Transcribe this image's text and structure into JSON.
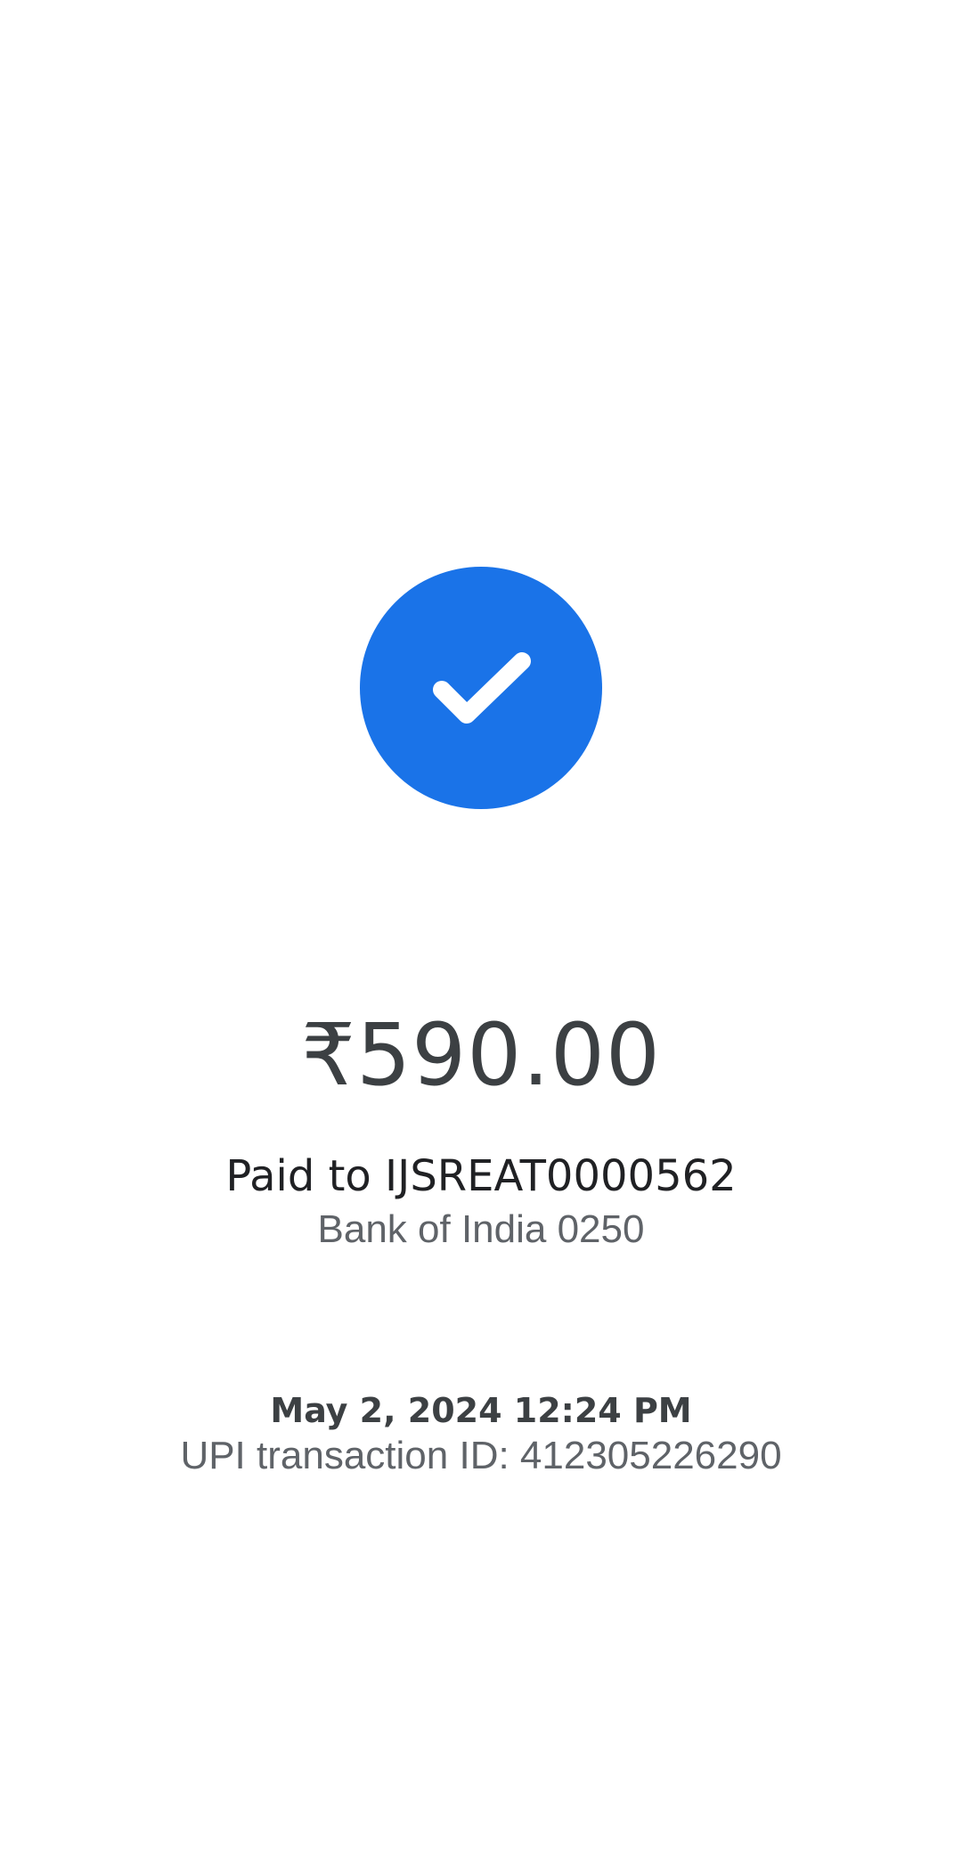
{
  "status": {
    "icon": "check-icon",
    "color": "#1a73e8"
  },
  "payment": {
    "amount": "₹590.00",
    "paid_to": "Paid to IJSREAT0000562",
    "bank": "Bank of India 0250",
    "datetime": "May 2, 2024 12:24 PM",
    "transaction_id": "UPI transaction ID: 412305226290"
  }
}
